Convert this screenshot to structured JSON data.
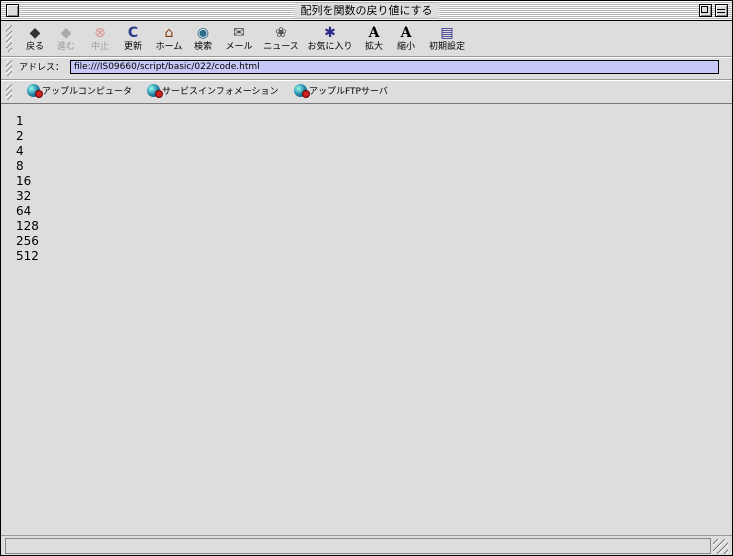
{
  "window": {
    "title": "配列を関数の戻り値にする"
  },
  "toolbar": {
    "buttons": [
      {
        "label": "戻る",
        "icon": "back-arrow-icon",
        "glyph": "◆",
        "enabled": true
      },
      {
        "label": "進む",
        "icon": "forward-arrow-icon",
        "glyph": "◆",
        "enabled": false
      },
      {
        "label": "中止",
        "icon": "stop-icon",
        "glyph": "⊗",
        "enabled": false
      },
      {
        "label": "更新",
        "icon": "reload-icon",
        "glyph": "C",
        "enabled": true
      },
      {
        "label": "ホーム",
        "icon": "home-icon",
        "glyph": "⌂",
        "enabled": true
      },
      {
        "label": "検索",
        "icon": "search-globe-icon",
        "glyph": "◉",
        "enabled": true
      },
      {
        "label": "メール",
        "icon": "mail-icon",
        "glyph": "✉",
        "enabled": true
      },
      {
        "label": "ニュース",
        "icon": "news-icon",
        "glyph": "❀",
        "enabled": true
      },
      {
        "label": "お気に入り",
        "icon": "favorites-icon",
        "glyph": "✱",
        "enabled": true
      },
      {
        "label": "拡大",
        "icon": "text-larger-icon",
        "glyph": "A",
        "enabled": true
      },
      {
        "label": "縮小",
        "icon": "text-smaller-icon",
        "glyph": "A",
        "enabled": true
      },
      {
        "label": "初期設定",
        "icon": "preferences-icon",
        "glyph": "▤",
        "enabled": true
      }
    ]
  },
  "address": {
    "label": "アドレス：",
    "url": "file:///IS09660/script/basic/022/code.html"
  },
  "favorites": [
    {
      "label": "アップルコンピュータ",
      "icon": "globe-icon"
    },
    {
      "label": "サービスインフォメーション",
      "icon": "globe-icon"
    },
    {
      "label": "アップルFTPサーバ",
      "icon": "globe-icon"
    }
  ],
  "content": {
    "lines": [
      "1",
      "2",
      "4",
      "8",
      "16",
      "32",
      "64",
      "128",
      "256",
      "512"
    ]
  },
  "status": {
    "text": ""
  }
}
